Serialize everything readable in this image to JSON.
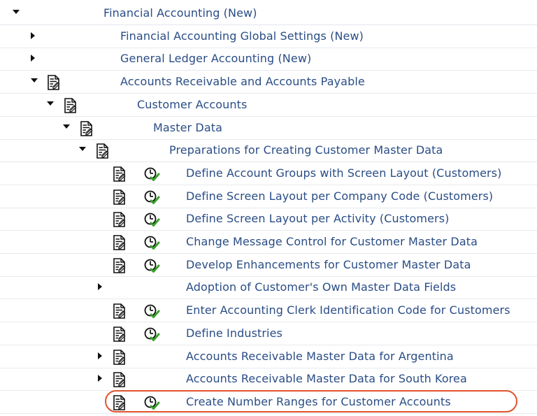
{
  "tree": {
    "rows": [
      {
        "label": "Financial Accounting (New)",
        "expander": "down",
        "has_doc": false,
        "has_clock": false
      },
      {
        "label": "Financial Accounting Global Settings (New)",
        "expander": "right",
        "has_doc": false,
        "has_clock": false
      },
      {
        "label": "General Ledger Accounting (New)",
        "expander": "right",
        "has_doc": false,
        "has_clock": false
      },
      {
        "label": "Accounts Receivable and Accounts Payable",
        "expander": "down",
        "has_doc": true,
        "has_clock": false
      },
      {
        "label": "Customer Accounts",
        "expander": "down",
        "has_doc": true,
        "has_clock": false
      },
      {
        "label": "Master Data",
        "expander": "down",
        "has_doc": true,
        "has_clock": false
      },
      {
        "label": "Preparations for Creating Customer Master Data",
        "expander": "down",
        "has_doc": true,
        "has_clock": false
      },
      {
        "label": "Define Account Groups with Screen Layout (Customers)",
        "expander": "none",
        "has_doc": true,
        "has_clock": true
      },
      {
        "label": "Define Screen Layout per Company Code (Customers)",
        "expander": "none",
        "has_doc": true,
        "has_clock": true
      },
      {
        "label": "Define Screen Layout per Activity (Customers)",
        "expander": "none",
        "has_doc": true,
        "has_clock": true
      },
      {
        "label": "Change Message Control for Customer Master Data",
        "expander": "none",
        "has_doc": true,
        "has_clock": true
      },
      {
        "label": "Develop Enhancements for Customer Master Data",
        "expander": "none",
        "has_doc": true,
        "has_clock": true
      },
      {
        "label": "Adoption of Customer's Own Master Data Fields",
        "expander": "right",
        "has_doc": false,
        "has_clock": false
      },
      {
        "label": "Enter Accounting Clerk Identification Code for Customers",
        "expander": "none",
        "has_doc": true,
        "has_clock": true
      },
      {
        "label": "Define Industries",
        "expander": "none",
        "has_doc": true,
        "has_clock": true
      },
      {
        "label": "Accounts Receivable Master Data for Argentina",
        "expander": "right",
        "has_doc": true,
        "has_clock": false
      },
      {
        "label": "Accounts Receivable Master Data for South Korea",
        "expander": "right",
        "has_doc": true,
        "has_clock": false
      },
      {
        "label": "Create Number Ranges for Customer Accounts",
        "expander": "none",
        "has_doc": true,
        "has_clock": true,
        "highlighted": true
      }
    ]
  },
  "icons": {
    "expand": "triangle-down-icon",
    "collapse": "triangle-right-icon",
    "doc": "documentation-icon",
    "execute": "execute-clock-check-icon"
  },
  "colors": {
    "label": "#2a4d86",
    "highlight_border": "#e0522c",
    "check_green": "#3aa02c"
  }
}
